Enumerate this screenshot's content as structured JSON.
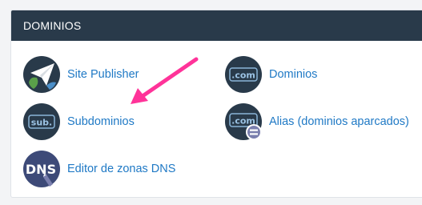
{
  "panel": {
    "title": "DOMINIOS"
  },
  "items": [
    {
      "label": "Site Publisher",
      "icon": "site-publisher-icon"
    },
    {
      "label": "Dominios",
      "icon": "domains-icon",
      "icon_text": ".com"
    },
    {
      "label": "Subdominios",
      "icon": "subdomains-icon",
      "icon_text": "sub."
    },
    {
      "label": "Alias (dominios aparcados)",
      "icon": "aliases-icon",
      "icon_text": ".com"
    },
    {
      "label": "Editor de zonas DNS",
      "icon": "dns-zone-editor-icon",
      "icon_text": "DNS"
    }
  ],
  "colors": {
    "header_bg": "#293a4a",
    "link": "#1f79c5",
    "icon_bg": "#293a4a",
    "annotation_arrow": "#ff3399"
  }
}
